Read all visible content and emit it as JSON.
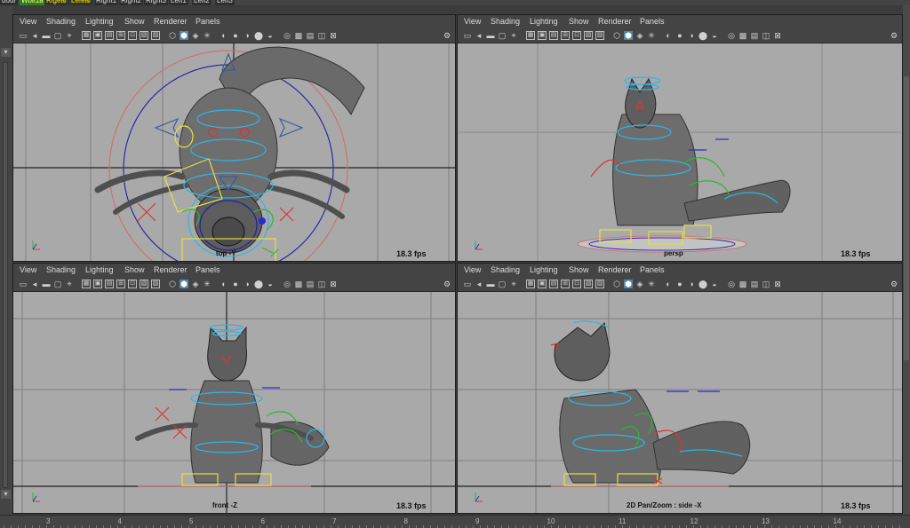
{
  "layer_tags": [
    {
      "label": "dour",
      "color": "#2e2e2e",
      "text": "#dddddd"
    },
    {
      "label": "Wolf1a",
      "color": "#2e7d2e",
      "text": "#ffff66"
    },
    {
      "label": "Rigear",
      "color": "#333333",
      "text": "#ffee00"
    },
    {
      "label": "Lefear",
      "color": "#333333",
      "text": "#ffee00"
    },
    {
      "label": "Right1",
      "color": "#2e2e2e",
      "text": "#dddddd"
    },
    {
      "label": "Right2",
      "color": "#2e2e2e",
      "text": "#dddddd"
    },
    {
      "label": "Right3",
      "color": "#2e2e2e",
      "text": "#dddddd"
    },
    {
      "label": "Left1",
      "color": "#2e2e2e",
      "text": "#dddddd"
    },
    {
      "label": "Left2",
      "color": "#2e2e2e",
      "text": "#dddddd"
    },
    {
      "label": "Left3",
      "color": "#2e2e2e",
      "text": "#dddddd"
    }
  ],
  "menu": [
    "View",
    "Shading",
    "Lighting",
    "Show",
    "Renderer",
    "Panels"
  ],
  "panels": [
    {
      "id": "top",
      "camera": "top -Y",
      "fps": "18.3 fps"
    },
    {
      "id": "persp",
      "camera": "persp",
      "fps": "18.3 fps"
    },
    {
      "id": "front",
      "camera": "front -Z",
      "fps": "18.3 fps"
    },
    {
      "id": "side",
      "camera": "2D Pan/Zoom : side -X",
      "fps": "18.3 fps"
    }
  ],
  "toolbar_icons": [
    "camera-icon",
    "camera-select-icon",
    "bookmark-icon",
    "image-plane-icon",
    "snapshot-icon",
    "grid-icon",
    "film-gate-icon",
    "resolution-gate-icon",
    "gate-mask-icon",
    "field-chart-icon",
    "safe-action-icon",
    "safe-title-icon",
    "wireframe-icon",
    "smooth-shade-icon",
    "textured-icon",
    "lights-icon",
    "shadows-icon",
    "ambient-occlusion-icon",
    "motion-blur-icon",
    "anti-alias-icon",
    "depth-of-field-icon",
    "isolate-icon",
    "xray-icon",
    "xray-joints-icon",
    "backface-icon",
    "exposure-icon"
  ],
  "ruler": {
    "ticks": [
      "3",
      "4",
      "5",
      "6",
      "7",
      "8",
      "9",
      "10",
      "11",
      "12",
      "13",
      "14"
    ]
  },
  "axis": {
    "x": "x",
    "y": "y",
    "z": "z"
  }
}
